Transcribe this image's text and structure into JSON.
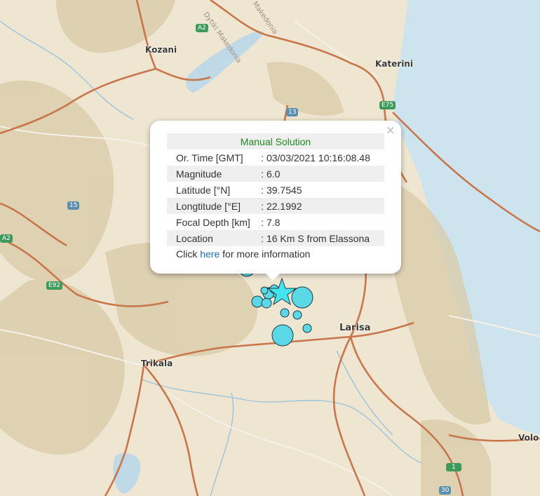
{
  "map": {
    "colors": {
      "land": "#efe6d2",
      "sea": "#cde3ee",
      "lake": "#bfd9e6",
      "mountain": "#d6c8a6",
      "road_major": "#c8764a",
      "road_minor": "#f4f0e8",
      "river": "#9cc4dc",
      "quake_fill": "#5bd8e6",
      "quake_stroke": "#1f3a40"
    },
    "cities": [
      "Kozani",
      "Katerini",
      "Larisa",
      "Trikala",
      "Volo"
    ],
    "road_shields": [
      "A2",
      "13",
      "E75",
      "15",
      "E92",
      "A2",
      "1",
      "30"
    ],
    "region_labels": [
      "Dytiki Makedonia",
      "Makedonia"
    ]
  },
  "popup": {
    "title": "Manual Solution",
    "close_glyph": "×",
    "rows": [
      {
        "label": "Or. Time [GMT]",
        "value": ": 03/03/2021 10:16:08.48"
      },
      {
        "label": "Magnitude",
        "value": ": 6.0"
      },
      {
        "label": "Latitude [°N]",
        "value": ": 39.7545"
      },
      {
        "label": "Longtitude [°E]",
        "value": ": 22.1992"
      },
      {
        "label": "Focal Depth [km]",
        "value": ": 7.8"
      },
      {
        "label": "Location",
        "value": ": 16 Km S from Elassona"
      }
    ],
    "more_prefix": "Click ",
    "more_link": "here",
    "more_suffix": " for more information"
  },
  "markers": {
    "mainshock_icon": "star-icon",
    "aftershock_icon": "circle-icon"
  }
}
